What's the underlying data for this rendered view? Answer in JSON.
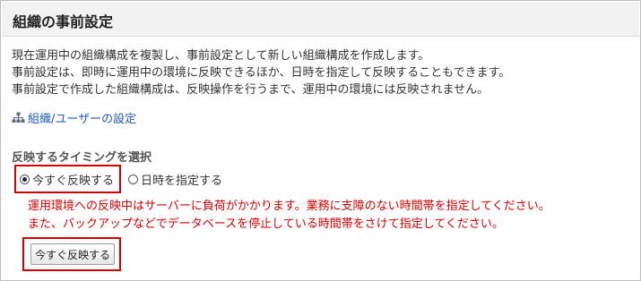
{
  "header": {
    "title": "組織の事前設定"
  },
  "description": {
    "lines": [
      "現在運用中の組織構成を複製し、事前設定として新しい組織構成を作成します。",
      "事前設定は、即時に運用中の環境に反映できるほか、日時を指定して反映することもできます。",
      "事前設定で作成した組織構成は、反映操作を行うまで、運用中の環境には反映されません。"
    ]
  },
  "link": {
    "label": "組織/ユーザーの設定",
    "icon": "org-tree-icon"
  },
  "timing": {
    "label": "反映するタイミングを選択",
    "options": [
      {
        "label": "今すぐ反映する",
        "selected": true
      },
      {
        "label": "日時を指定する",
        "selected": false
      }
    ]
  },
  "warning": {
    "lines": [
      "運用環境への反映中はサーバーに負荷がかかります。業務に支障のない時間帯を指定してください。",
      "また、バックアップなどでデータベースを停止している時間帯をさけて指定してください。"
    ]
  },
  "action": {
    "button_label": "今すぐ反映する"
  },
  "colors": {
    "highlight": "#d20000",
    "warning_text": "#d20000",
    "link": "#1e5bb8",
    "header_bg": "#f2f2f2"
  }
}
